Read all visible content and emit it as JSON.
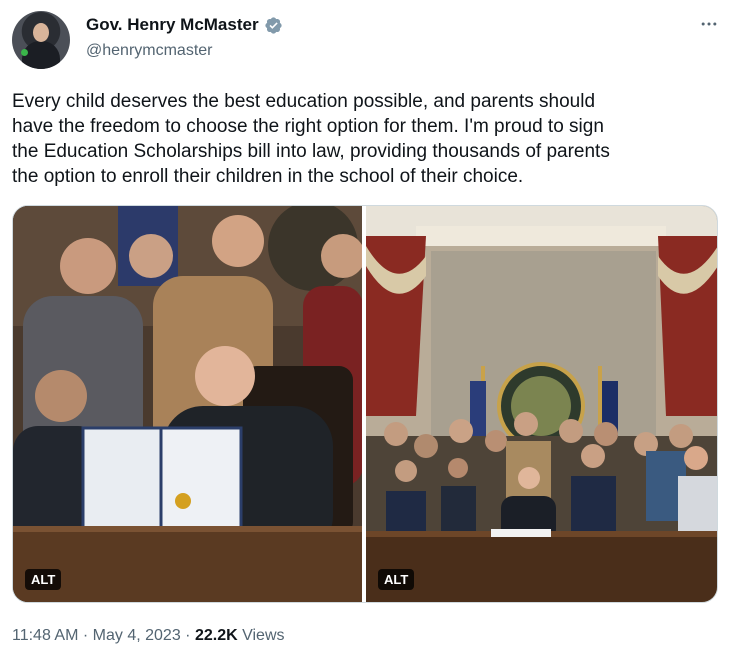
{
  "author": {
    "display_name": "Gov. Henry McMaster",
    "handle": "@henrymcmaster",
    "verified_icon": "verified-badge-icon"
  },
  "tweet": {
    "text": "Every child deserves the best education possible, and parents should\nhave the freedom to choose the right option for them. I'm proud to sign\nthe Education Scholarships bill into law, providing thousands of parents\nthe option to enroll their children in the school of their choice."
  },
  "media": {
    "photos": [
      {
        "alt_label": "ALT"
      },
      {
        "alt_label": "ALT"
      }
    ]
  },
  "meta": {
    "time": "11:48 AM",
    "separator": "·",
    "date": "May 4, 2023",
    "views_count": "22.2K",
    "views_label": "Views"
  },
  "colors": {
    "text_primary": "#0f1419",
    "text_secondary": "#536471",
    "verified": "#829aab",
    "border": "#cfd9de"
  }
}
